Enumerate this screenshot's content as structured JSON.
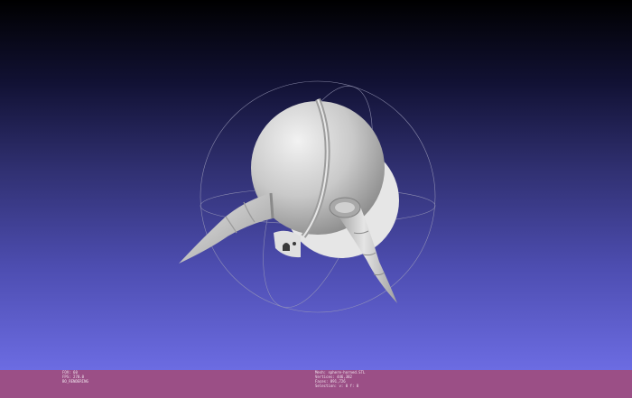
{
  "colors": {
    "background_top": "#000000",
    "background_bottom": "#6c6ce2",
    "status_bar": "#9b4f86",
    "model": "#c9c9c9"
  },
  "model": {
    "description_icon": "3d-mesh-sphere-with-horns"
  },
  "status_left": {
    "line1": "FOV: 60",
    "line2": "FPS:  270.0",
    "line3": "BO_RENDERING"
  },
  "status_right": {
    "line1": "Mesh: sphere-horned.STL",
    "line2": "Vertices: 446,382",
    "line3": "Faces: 891,726",
    "line4": "Selection: v: 0 f: 0"
  }
}
